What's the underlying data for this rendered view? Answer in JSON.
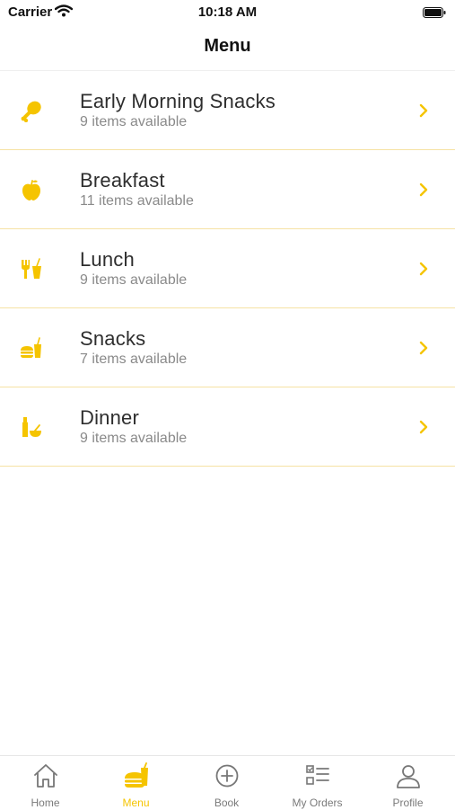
{
  "status_bar": {
    "carrier": "Carrier",
    "time": "10:18 AM"
  },
  "nav": {
    "title": "Menu"
  },
  "accent_color": "#F5C400",
  "menu_items": [
    {
      "title": "Early Morning Snacks",
      "subtitle": "9 items available",
      "icon": "drumstick-icon"
    },
    {
      "title": "Breakfast",
      "subtitle": "11 items available",
      "icon": "apple-icon"
    },
    {
      "title": "Lunch",
      "subtitle": "9 items available",
      "icon": "fork-drink-icon"
    },
    {
      "title": "Snacks",
      "subtitle": "7 items available",
      "icon": "burger-drink-icon"
    },
    {
      "title": "Dinner",
      "subtitle": "9 items available",
      "icon": "bottle-bowl-icon"
    }
  ],
  "tab_bar": {
    "active": "Menu",
    "tabs": [
      {
        "label": "Home",
        "icon": "home-icon"
      },
      {
        "label": "Menu",
        "icon": "menu-food-icon"
      },
      {
        "label": "Book",
        "icon": "plus-circle-icon"
      },
      {
        "label": "My Orders",
        "icon": "checklist-icon"
      },
      {
        "label": "Profile",
        "icon": "person-icon"
      }
    ]
  }
}
